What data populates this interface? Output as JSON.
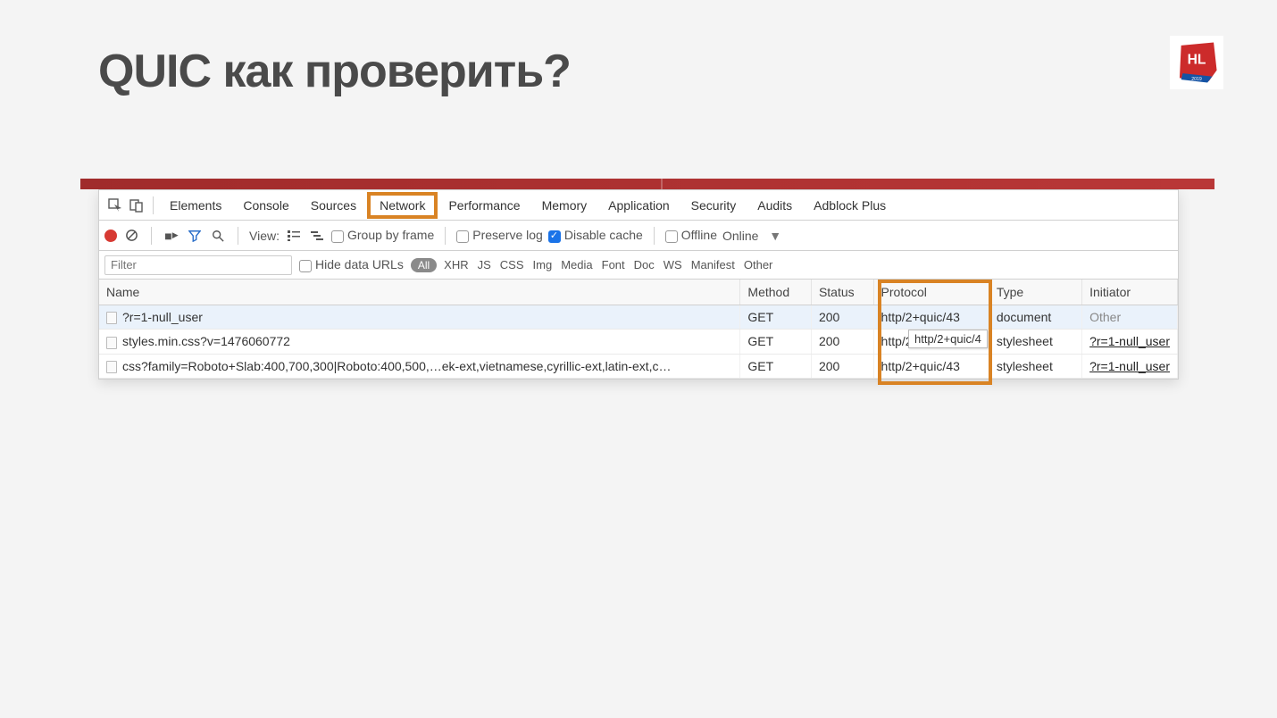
{
  "slide": {
    "title": "QUIC как проверить?",
    "logo_label": "HL",
    "logo_year": "2019"
  },
  "devtools": {
    "tabs": [
      "Elements",
      "Console",
      "Sources",
      "Network",
      "Performance",
      "Memory",
      "Application",
      "Security",
      "Audits",
      "Adblock Plus"
    ],
    "active_tab_index": 3,
    "toolbar": {
      "view_label": "View:",
      "group_by_frame": "Group by frame",
      "preserve_log": "Preserve log",
      "disable_cache": "Disable cache",
      "offline": "Offline",
      "online": "Online"
    },
    "filter": {
      "placeholder": "Filter",
      "hide_data_urls": "Hide data URLs",
      "all_pill": "All",
      "types": [
        "XHR",
        "JS",
        "CSS",
        "Img",
        "Media",
        "Font",
        "Doc",
        "WS",
        "Manifest",
        "Other"
      ]
    },
    "table": {
      "headers": {
        "name": "Name",
        "method": "Method",
        "status": "Status",
        "protocol": "Protocol",
        "type": "Type",
        "initiator": "Initiator"
      },
      "rows": [
        {
          "name": "?r=1-null_user",
          "method": "GET",
          "status": "200",
          "protocol": "http/2+quic/43",
          "type": "document",
          "initiator": "Other",
          "initiator_link": false,
          "selected": true
        },
        {
          "name": "styles.min.css?v=1476060772",
          "method": "GET",
          "status": "200",
          "protocol": "http/2+quic/43",
          "type": "stylesheet",
          "initiator": "?r=1-null_user",
          "initiator_link": true,
          "selected": false
        },
        {
          "name": "css?family=Roboto+Slab:400,700,300|Roboto:400,500,…ek-ext,vietnamese,cyrillic-ext,latin-ext,c…",
          "method": "GET",
          "status": "200",
          "protocol": "http/2+quic/43",
          "type": "stylesheet",
          "initiator": "?r=1-null_user",
          "initiator_link": true,
          "selected": false
        }
      ],
      "tooltip": "http/2+quic/4"
    }
  }
}
